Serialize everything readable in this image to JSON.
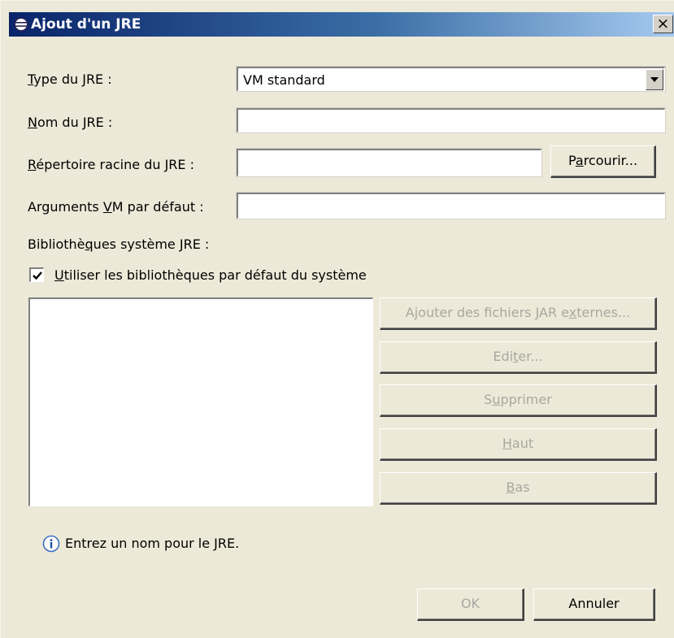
{
  "dialog": {
    "title": "Ajout d'un JRE",
    "close_label": "×",
    "title_icon": "eclipse-icon"
  },
  "form": {
    "jre_type": {
      "label_accel": "T",
      "label_rest": "ype du JRE :",
      "value": "VM standard"
    },
    "jre_name": {
      "label_accel": "N",
      "label_rest": "om du JRE :",
      "value": ""
    },
    "jre_home": {
      "label_accel": "R",
      "label_rest": "épertoire racine du JRE :",
      "value": ""
    },
    "browse_button": {
      "pre": "P",
      "accel": "a",
      "post": "rcourir..."
    },
    "vm_args": {
      "label_pre": "Arguments ",
      "label_accel": "V",
      "label_post": "M par défaut :",
      "value": ""
    }
  },
  "libraries": {
    "heading_pre": "Bibliothè",
    "heading_accel": "q",
    "heading_post": "ues système JRE :",
    "use_default": {
      "checked": true,
      "accel": "U",
      "rest": "tiliser les bibliothèques par défaut du système"
    },
    "items": [],
    "buttons": {
      "add_jars": {
        "pre": "Ajouter des fichiers JAR e",
        "accel": "x",
        "post": "ternes...",
        "enabled": false
      },
      "edit": {
        "pre": "Edi",
        "accel": "t",
        "post": "er...",
        "enabled": false
      },
      "remove": {
        "pre": "S",
        "accel": "u",
        "post": "pprimer",
        "enabled": false
      },
      "up": {
        "pre": "",
        "accel": "H",
        "post": "aut",
        "enabled": false
      },
      "down": {
        "pre": "",
        "accel": "B",
        "post": "as",
        "enabled": false
      }
    }
  },
  "status": {
    "icon": "info-icon",
    "message": "Entrez un nom pour le JRE."
  },
  "footer": {
    "ok": {
      "label": "OK",
      "enabled": false
    },
    "cancel": {
      "label": "Annuler",
      "enabled": true
    }
  }
}
